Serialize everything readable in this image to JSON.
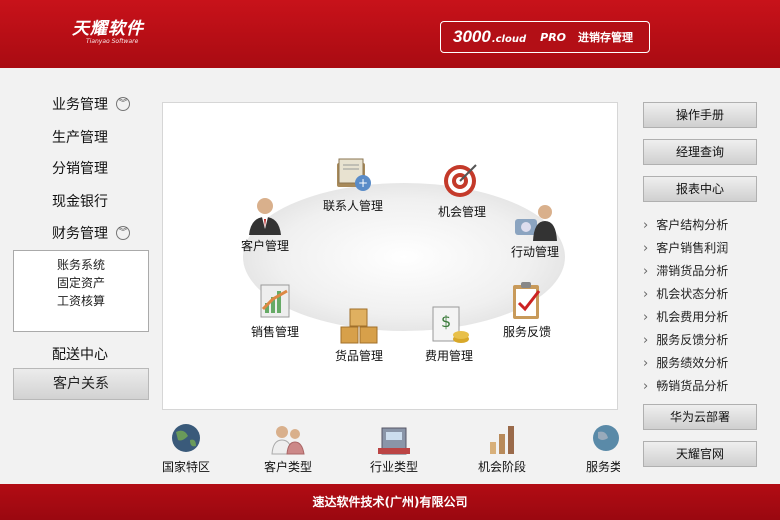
{
  "header": {
    "logo_cn": "天耀软件",
    "logo_en": "Tianyao Software",
    "badge_num": "3000",
    "badge_cloud": ".cloud",
    "badge_pro": "PRO",
    "badge_text": "进销存管理"
  },
  "left_menu": {
    "business": "业务管理",
    "production": "生产管理",
    "distribution": "分销管理",
    "cash_bank": "现金银行",
    "finance": "财务管理",
    "finance_sub": [
      "账务系统",
      "固定资产",
      "工资核算"
    ],
    "delivery": "配送中心",
    "customer_relation": "客户关系"
  },
  "center": {
    "nodes": {
      "contacts": "联系人管理",
      "opportunity": "机会管理",
      "customer": "客户管理",
      "action": "行动管理",
      "sales": "销售管理",
      "service_feedback": "服务反馈",
      "goods": "货品管理",
      "expense": "费用管理"
    }
  },
  "bottom_bar": [
    "国家特区",
    "客户类型",
    "行业类型",
    "机会阶段",
    "服务类"
  ],
  "right": {
    "manual": "操作手册",
    "manager_query": "经理查询",
    "report_center": "报表中心",
    "reports": [
      "客户结构分析",
      "客户销售利润",
      "滞销货品分析",
      "机会状态分析",
      "机会费用分析",
      "服务反馈分析",
      "服务绩效分析",
      "畅销货品分析"
    ],
    "huawei": "华为云部署",
    "official": "天耀官网"
  },
  "footer": {
    "company": "速达软件技术(广州)有限公司"
  }
}
